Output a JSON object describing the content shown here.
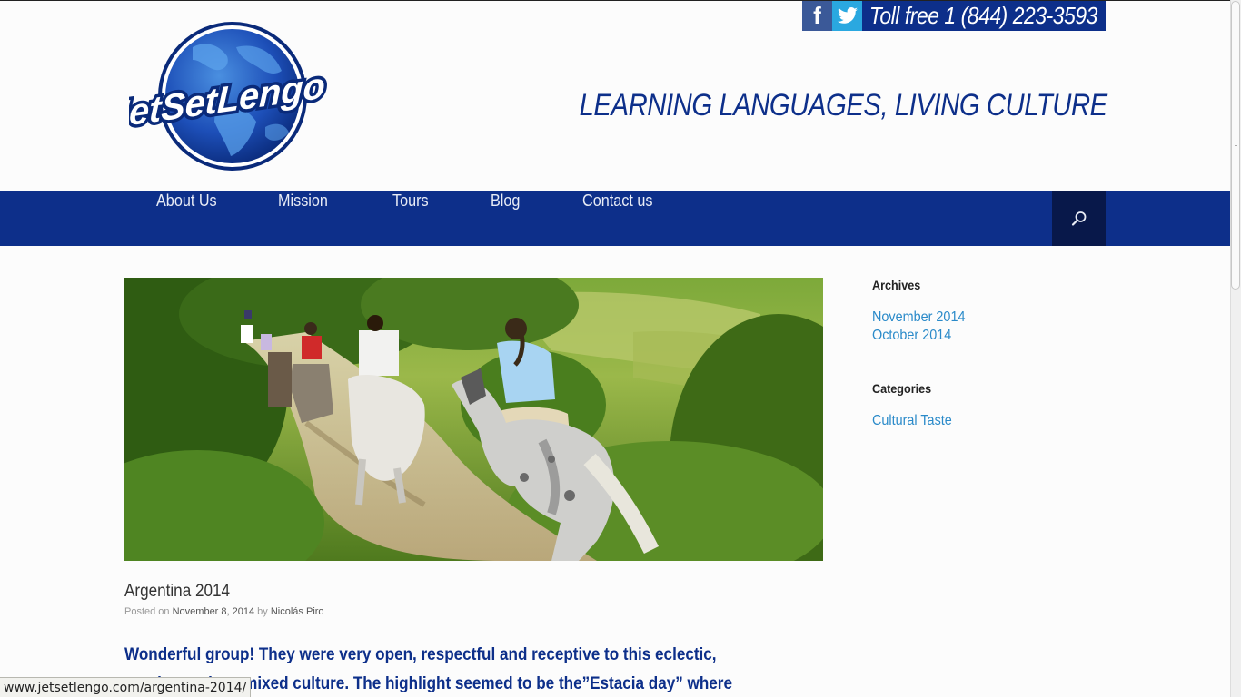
{
  "header": {
    "social": [
      {
        "name": "facebook",
        "glyph": "f",
        "color": "#3b5998"
      },
      {
        "name": "twitter",
        "glyph": "bird",
        "color": "#2aa8e0"
      }
    ],
    "phone": "Toll free 1 (844) 223-3593",
    "logo_text": "JetSetLengo",
    "tagline": "LEARNING LANGUAGES, LIVING CULTURE"
  },
  "nav": {
    "items": [
      "About Us",
      "Mission",
      "Tours",
      "Blog",
      "Contact us"
    ],
    "search_icon": "search-icon"
  },
  "post": {
    "title": "Argentina 2014",
    "meta_prefix": "Posted on",
    "date": "November 8, 2014",
    "meta_by": "by",
    "author": "Nicolás Piro",
    "body_line1": "Wonderful group! They were very open, respectful and receptive to this eclectic,",
    "body_line2": "south american mixed culture. The highlight seemed to be the”Estacia day” where"
  },
  "sidebar": {
    "archives_title": "Archives",
    "archives": [
      "November 2014",
      "October 2014"
    ],
    "categories_title": "Categories",
    "categories": [
      "Cultural Taste"
    ]
  },
  "status_url": "www.jetsetlengo.com/argentina-2014/",
  "colors": {
    "brand_blue": "#0d2f8a",
    "search_bg": "#08184a",
    "link_blue": "#2a8ac9"
  }
}
